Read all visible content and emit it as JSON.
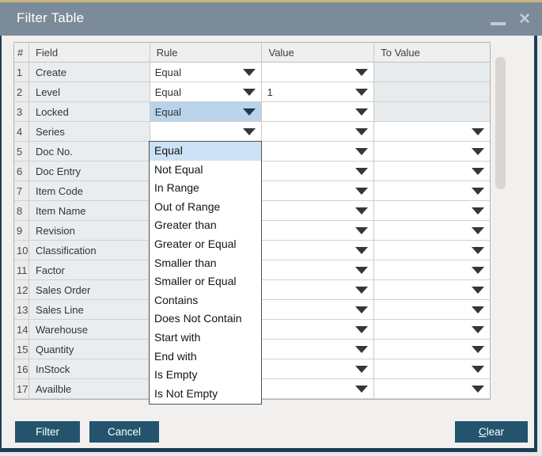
{
  "window": {
    "title": "Filter Table"
  },
  "table": {
    "headers": {
      "num": "#",
      "field": "Field",
      "rule": "Rule",
      "value": "Value",
      "to_value": "To Value"
    },
    "rows": [
      {
        "num": "1",
        "field": "Create",
        "rule": "Equal",
        "value": "",
        "to_value": "",
        "to_enabled": false,
        "rule_selected": false
      },
      {
        "num": "2",
        "field": "Level",
        "rule": "Equal",
        "value": "1",
        "to_value": "",
        "to_enabled": false,
        "rule_selected": false
      },
      {
        "num": "3",
        "field": "Locked",
        "rule": "Equal",
        "value": "",
        "to_value": "",
        "to_enabled": false,
        "rule_selected": true
      },
      {
        "num": "4",
        "field": "Series",
        "rule": "",
        "value": "",
        "to_value": "",
        "to_enabled": true,
        "rule_selected": false
      },
      {
        "num": "5",
        "field": "Doc No.",
        "rule": "",
        "value": "",
        "to_value": "",
        "to_enabled": true,
        "rule_selected": false
      },
      {
        "num": "6",
        "field": "Doc Entry",
        "rule": "",
        "value": "",
        "to_value": "",
        "to_enabled": true,
        "rule_selected": false
      },
      {
        "num": "7",
        "field": "Item Code",
        "rule": "",
        "value": "",
        "to_value": "",
        "to_enabled": true,
        "rule_selected": false
      },
      {
        "num": "8",
        "field": "Item Name",
        "rule": "",
        "value": "",
        "to_value": "",
        "to_enabled": true,
        "rule_selected": false
      },
      {
        "num": "9",
        "field": "Revision",
        "rule": "",
        "value": "",
        "to_value": "",
        "to_enabled": true,
        "rule_selected": false
      },
      {
        "num": "10",
        "field": "Classification",
        "rule": "",
        "value": "",
        "to_value": "",
        "to_enabled": true,
        "rule_selected": false
      },
      {
        "num": "11",
        "field": "Factor",
        "rule": "",
        "value": "",
        "to_value": "",
        "to_enabled": true,
        "rule_selected": false
      },
      {
        "num": "12",
        "field": "Sales Order",
        "rule": "",
        "value": "",
        "to_value": "",
        "to_enabled": true,
        "rule_selected": false
      },
      {
        "num": "13",
        "field": "Sales Line",
        "rule": "",
        "value": "",
        "to_value": "",
        "to_enabled": true,
        "rule_selected": false
      },
      {
        "num": "14",
        "field": "Warehouse",
        "rule": "",
        "value": "",
        "to_value": "",
        "to_enabled": true,
        "rule_selected": false
      },
      {
        "num": "15",
        "field": "Quantity",
        "rule": "",
        "value": "",
        "to_value": "",
        "to_enabled": true,
        "rule_selected": false
      },
      {
        "num": "16",
        "field": "InStock",
        "rule": "",
        "value": "",
        "to_value": "",
        "to_enabled": true,
        "rule_selected": false
      },
      {
        "num": "17",
        "field": "Availble",
        "rule": "",
        "value": "",
        "to_value": "",
        "to_enabled": true,
        "rule_selected": false
      }
    ]
  },
  "rule_dropdown": {
    "items": [
      "Equal",
      "Not Equal",
      "In Range",
      "Out of Range",
      "Greater than",
      "Greater or Equal",
      "Smaller than",
      "Smaller or Equal",
      "Contains",
      "Does Not Contain",
      "Start with",
      "End with",
      "Is Empty",
      "Is Not Empty"
    ],
    "selected_item": "Equal"
  },
  "buttons": {
    "filter": "Filter",
    "cancel": "Cancel",
    "clear_accel": "C",
    "clear_rest": "lear"
  },
  "colors": {
    "titlebar": "#7c8b99",
    "top_accent": "#c9b57e",
    "frame": "#1c3e55",
    "button": "#24536e",
    "selected_cell": "#b9d3ea",
    "dropdown_highlight": "#cde2f6",
    "field_cell": "#e9edf0"
  }
}
